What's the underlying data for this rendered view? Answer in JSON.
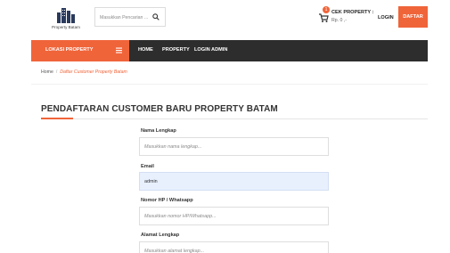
{
  "brand": {
    "logo_text": "Property Batam"
  },
  "search": {
    "placeholder": "Masukkan Pencarian ..."
  },
  "header": {
    "cart_count": "1",
    "cek_property_label": "CEK PROPERTY :",
    "cek_property_value": "Rp. 0 ,-",
    "login_label": "LOGIN",
    "daftar_label": "DAFTAR"
  },
  "nav": {
    "category_label": "LOKASI PROPERTY",
    "links": [
      "HOME",
      "PROPERTY",
      "LOGIN ADMIN"
    ]
  },
  "breadcrumb": {
    "home": "Home",
    "separator": "/",
    "current": "Daftar Customer Property Batam"
  },
  "page": {
    "title": "PENDAFTARAN CUSTOMER BARU PROPERTY BATAM"
  },
  "form": {
    "fields": [
      {
        "label": "Nama Lengkap",
        "value": "",
        "placeholder": "Masukkan nama lengkap..."
      },
      {
        "label": "Email",
        "value": "admin",
        "placeholder": ""
      },
      {
        "label": "Nomor HP / Whatsapp",
        "value": "",
        "placeholder": "Masukkan nomor HP/Whatsapp..."
      },
      {
        "label": "Alamat Lengkap",
        "value": "",
        "placeholder": "Masukkan alamat lengkap..."
      }
    ]
  },
  "colors": {
    "accent": "#f0643a",
    "nav_bg": "#2d2d2d",
    "autofill_bg": "#e8f0fe"
  },
  "icons": {
    "search": "search-icon",
    "cart": "cart-icon",
    "menu": "menu-icon",
    "logo": "building-logo-icon"
  }
}
